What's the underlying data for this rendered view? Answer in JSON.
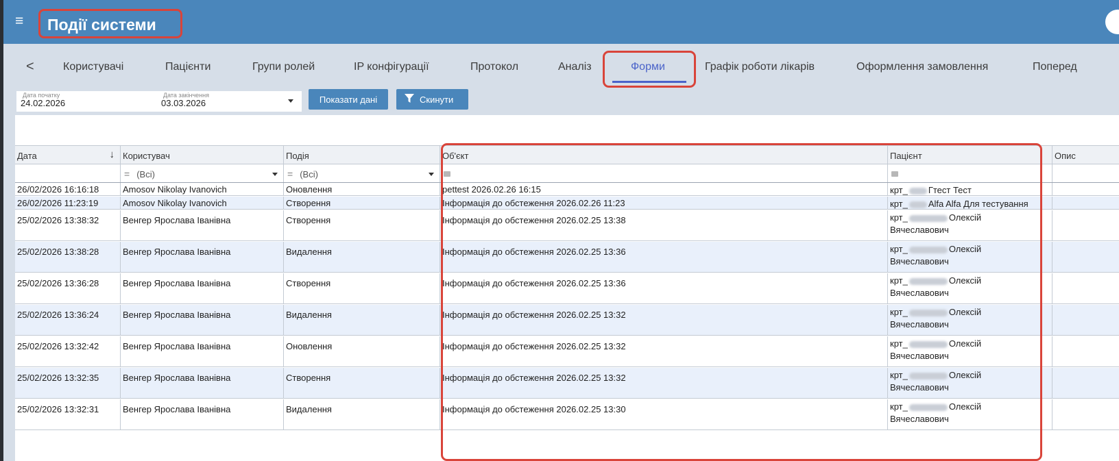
{
  "header": {
    "title": "Події системи",
    "menu_icon": "hamburger-icon"
  },
  "tabs": [
    {
      "label": "<"
    },
    {
      "label": "Користувачі"
    },
    {
      "label": "Пацієнти"
    },
    {
      "label": "Групи ролей"
    },
    {
      "label": "IP конфігурації"
    },
    {
      "label": "Протокол"
    },
    {
      "label": "Аналіз"
    },
    {
      "label": "Форми",
      "active": true
    },
    {
      "label": "Графік роботи лікарів"
    },
    {
      "label": "Оформлення замовлення"
    },
    {
      "label": "Поперед"
    }
  ],
  "filters": {
    "start_label": "Дата початку",
    "start_value": "24.02.2026",
    "end_label": "Дата закінчення",
    "end_value": "03.03.2026",
    "show_button": "Показати дані",
    "reset_button": "Скинути"
  },
  "grid": {
    "columns": [
      "Дата",
      "Користувач",
      "Подія",
      "Об'єкт",
      "Пацієнт",
      "Опис"
    ],
    "filter_all": "(Всі)",
    "filter_eq": "=",
    "rows": [
      {
        "date": "26/02/2026 16:16:18",
        "user": "Amosov Nikolay Ivanovich",
        "event": "Оновлення",
        "object": "pettest 2026.02.26 16:15",
        "patient_pre": "крт_",
        "patient_post": "Гтест Тест",
        "patient_line2": ""
      },
      {
        "date": "26/02/2026 11:23:19",
        "user": "Amosov Nikolay Ivanovich",
        "event": "Створення",
        "object": "Інформація до обстеження 2026.02.26 11:23",
        "patient_pre": "крт_",
        "patient_post": "Alfa Alfa Для тестування",
        "patient_line2": ""
      },
      {
        "date": "25/02/2026 13:38:32",
        "user": "Венгер Ярослава Іванівна",
        "event": "Створення",
        "object": "Інформація до обстеження 2026.02.25 13:38",
        "patient_pre": "крт_",
        "patient_post": "Олексій",
        "patient_line2": "Вячеславович"
      },
      {
        "date": "25/02/2026 13:38:28",
        "user": "Венгер Ярослава Іванівна",
        "event": "Видалення",
        "object": "Інформація до обстеження 2026.02.25 13:36",
        "patient_pre": "крт_",
        "patient_post": "Олексій",
        "patient_line2": "Вячеславович"
      },
      {
        "date": "25/02/2026 13:36:28",
        "user": "Венгер Ярослава Іванівна",
        "event": "Створення",
        "object": "Інформація до обстеження 2026.02.25 13:36",
        "patient_pre": "крт_",
        "patient_post": "Олексій",
        "patient_line2": "Вячеславович"
      },
      {
        "date": "25/02/2026 13:36:24",
        "user": "Венгер Ярослава Іванівна",
        "event": "Видалення",
        "object": "Інформація до обстеження 2026.02.25 13:32",
        "patient_pre": "крт_",
        "patient_post": "Олексій",
        "patient_line2": "Вячеславович"
      },
      {
        "date": "25/02/2026 13:32:42",
        "user": "Венгер Ярослава Іванівна",
        "event": "Оновлення",
        "object": "Інформація до обстеження 2026.02.25 13:32",
        "patient_pre": "крт_",
        "patient_post": "Олексій",
        "patient_line2": "Вячеславович"
      },
      {
        "date": "25/02/2026 13:32:35",
        "user": "Венгер Ярослава Іванівна",
        "event": "Створення",
        "object": "Інформація до обстеження 2026.02.25 13:32",
        "patient_pre": "крт_",
        "patient_post": "Олексій",
        "patient_line2": "Вячеславович"
      },
      {
        "date": "25/02/2026 13:32:31",
        "user": "Венгер Ярослава Іванівна",
        "event": "Видалення",
        "object": "Інформація до обстеження 2026.02.25 13:30",
        "patient_pre": "крт_",
        "patient_post": "Олексій",
        "patient_line2": "Вячеславович"
      }
    ]
  },
  "colors": {
    "header_bg": "#4a86bb",
    "active_tab": "#4a63c9",
    "highlight": "#d9443a",
    "row_alt": "#e9f0fb"
  }
}
